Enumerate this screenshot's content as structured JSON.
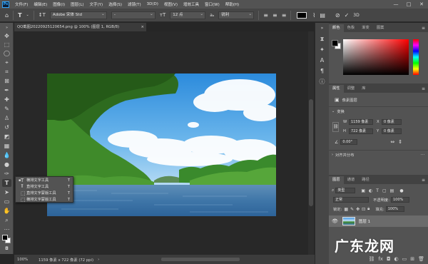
{
  "menubar": {
    "items": [
      "文件(F)",
      "编辑(E)",
      "图像(I)",
      "图层(L)",
      "文字(Y)",
      "选择(S)",
      "滤镜(T)",
      "3D(D)",
      "视图(V)",
      "增效工具",
      "窗口(W)",
      "帮助(H)"
    ],
    "logo": "Ps",
    "window_controls": [
      "—",
      "□",
      "✕"
    ]
  },
  "options_bar": {
    "font_family": "Adobe 宋体 Std",
    "font_style": "-",
    "font_size": "12 点",
    "antialias": "锐利",
    "icons": [
      "home-icon",
      "text-tool-icon",
      "text-orientation-icon",
      "font-size-icon",
      "align-left-icon",
      "align-center-icon",
      "align-right-icon",
      "color-swatch",
      "warp-text-icon",
      "character-panel-icon",
      "cancel-icon",
      "commit-icon",
      "3d-icon"
    ]
  },
  "document": {
    "tab_title": "QQ截图20220925120654.png @ 100% (图层 1, RGB/8)",
    "close": "×"
  },
  "tool_flyout": {
    "items": [
      {
        "label": "横排文字工具",
        "key": "T",
        "selected": true
      },
      {
        "label": "直排文字工具",
        "key": "T",
        "selected": false
      },
      {
        "label": "直排文字蒙版工具",
        "key": "T",
        "selected": false
      },
      {
        "label": "横排文字蒙版工具",
        "key": "T",
        "selected": false
      }
    ]
  },
  "status_bar": {
    "zoom": "100%",
    "doc_info": "1159 像素 x 722 像素 (72 ppi)",
    "arrow": "›"
  },
  "color_panel": {
    "tabs": [
      "颜色",
      "色板",
      "渐变",
      "图案"
    ],
    "foreground": "#000000",
    "background": "#ffffff"
  },
  "properties_panel": {
    "tabs": [
      "属性",
      "调整",
      "库"
    ],
    "layer_type": "像素图层",
    "transform_title": "变换",
    "w_label": "W",
    "w_value": "1159 像素",
    "h_label": "H",
    "h_value": "722 像素",
    "x_label": "X",
    "x_value": "0 像素",
    "y_label": "Y",
    "y_value": "0 像素",
    "angle": "0.00°",
    "align_title": "对齐并分布"
  },
  "layers_panel": {
    "tabs": [
      "图层",
      "通道",
      "路径"
    ],
    "filter_kind": "类型",
    "blend_mode": "正常",
    "opacity_label": "不透明度:",
    "opacity_value": "100%",
    "lock_label": "锁定:",
    "fill_label": "填充:",
    "fill_value": "100%",
    "layer_name": "图层 1"
  },
  "watermark": "广东龙网"
}
